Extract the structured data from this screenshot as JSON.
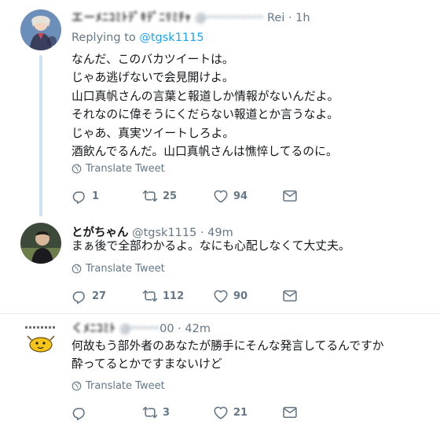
{
  "tweets": [
    {
      "author_name": "エーﾒﾆｺﾐﾄﾃﾞｷﾃﾞﾆﾘﾐﾁｬ",
      "author_handle": "@ｰｰｰｰｰｰｰｰｰｰ",
      "author_suffix": "Rei",
      "time": "· 1h",
      "replying_label": "Replying to",
      "replying_handle": "@tgsk1115",
      "lines": [
        "なんだ、このバカツイートは。",
        "じゃあ逃げないで会見開けよ。",
        "山口真帆さんの言葉と報道しか情報がないんだよ。",
        "それなのに偉そうにくだらない報道とか言うなよ。",
        "じゃあ、真実ツイートしろよ。",
        "酒飲んでるんだ。山口真帆さんは憔悴してるのに。"
      ],
      "translate": "Translate Tweet",
      "replies": "1",
      "retweets": "25",
      "likes": "94"
    },
    {
      "author_name": "とがちゃん",
      "author_handle": "@tgsk1115",
      "time": "· 49m",
      "lines": [
        "まぁ後で全部わかるよ。なにも心配しなくて大丈夫。"
      ],
      "translate": "Translate Tweet",
      "replies": "27",
      "retweets": "112",
      "likes": "90"
    },
    {
      "author_name": "くﾒﾆｺﾐﾄ",
      "author_handle": "@ｰｰｰｰｰ",
      "author_suffix": "00",
      "time": "· 42m",
      "lines": [
        "何故もう部外者のあなたが勝手にそんな発言してるんですか",
        "酔ってるとかですまないけど"
      ],
      "translate": "Translate Tweet",
      "replies": "",
      "retweets": "3",
      "likes": "21"
    }
  ],
  "colors": {
    "accent": "#1da1f2",
    "muted": "#657786",
    "thread_line": "#cce4f5",
    "divider": "#e6ecf0"
  },
  "icons": [
    "reply-icon",
    "retweet-icon",
    "like-icon",
    "direct-message-icon",
    "globe-icon"
  ]
}
